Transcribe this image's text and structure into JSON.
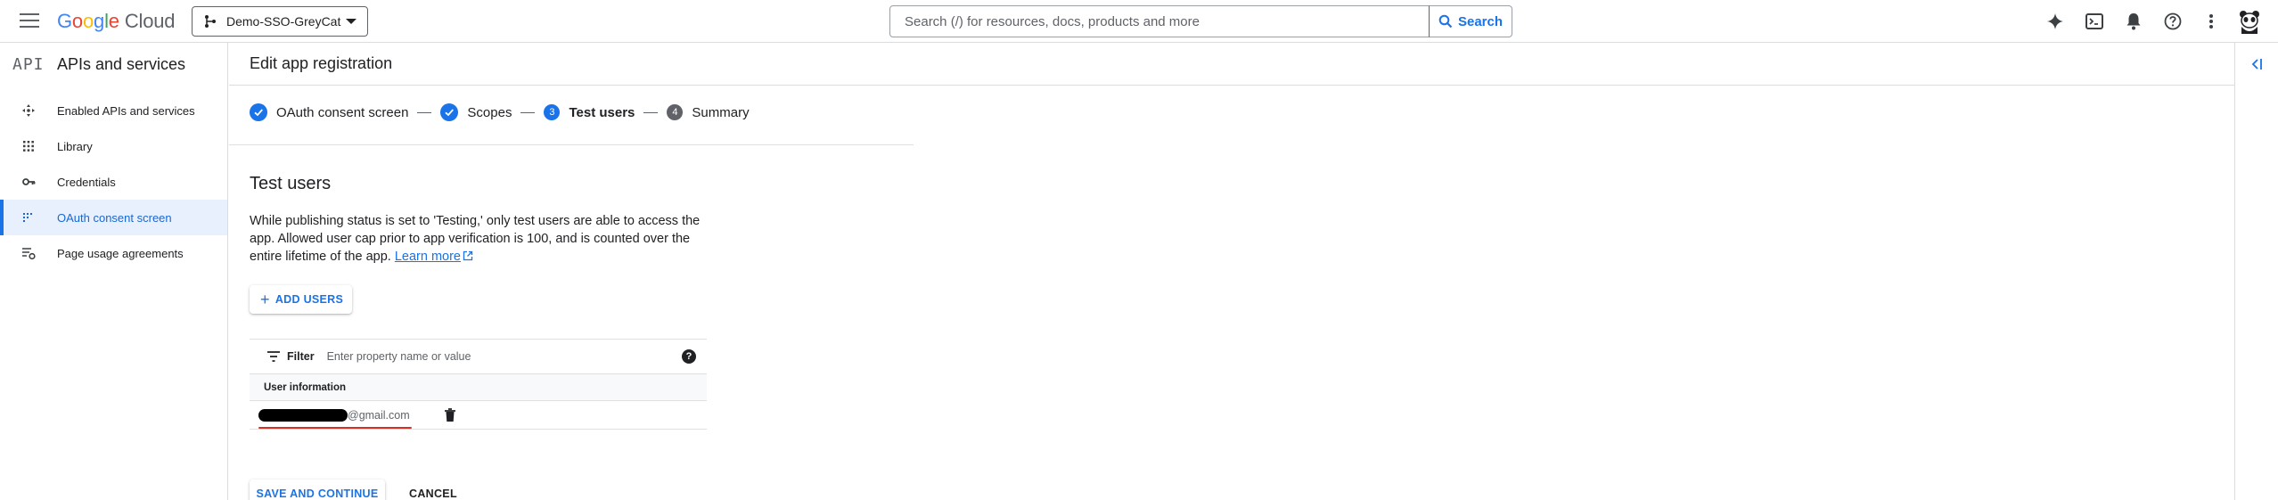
{
  "topbar": {
    "logo_google": [
      "G",
      "o",
      "o",
      "g",
      "l",
      "e"
    ],
    "logo_cloud": "Cloud",
    "project_name": "Demo-SSO-GreyCat",
    "search_placeholder": "Search (/) for resources, docs, products and more",
    "search_button": "Search",
    "icons": [
      "gemini-sparkle-icon",
      "cloud-shell-icon",
      "notifications-bell-icon",
      "help-icon",
      "more-vert-icon",
      "account-avatar-icon"
    ]
  },
  "sidebar": {
    "api_mark": "API",
    "title": "APIs and services",
    "items": [
      {
        "label": "Enabled APIs and services",
        "icon": "enabled-apis-icon"
      },
      {
        "label": "Library",
        "icon": "library-icon"
      },
      {
        "label": "Credentials",
        "icon": "key-icon"
      },
      {
        "label": "OAuth consent screen",
        "icon": "consent-screen-icon",
        "active": true
      },
      {
        "label": "Page usage agreements",
        "icon": "agreements-icon"
      }
    ]
  },
  "main": {
    "page_title": "Edit app registration",
    "steps": [
      {
        "label": "OAuth consent screen",
        "state": "done"
      },
      {
        "label": "Scopes",
        "state": "done"
      },
      {
        "number": "3",
        "label": "Test users",
        "state": "current"
      },
      {
        "number": "4",
        "label": "Summary",
        "state": "pending"
      }
    ],
    "section_title": "Test users",
    "description": "While publishing status is set to 'Testing,' only test users are able to access the app. Allowed user cap prior to app verification is 100, and is counted over the entire lifetime of the app.",
    "learn_more": "Learn more",
    "add_users_label": "ADD USERS",
    "filter_label": "Filter",
    "filter_placeholder": "Enter property name or value",
    "table_header": "User information",
    "users": [
      {
        "email_suffix": "@gmail.com"
      }
    ],
    "save_label": "SAVE AND CONTINUE",
    "cancel_label": "CANCEL"
  },
  "colors": {
    "accent": "#1a73e8",
    "active_bg": "#e8f0fe",
    "underline_red": "#d93025",
    "text": "#202124",
    "secondary": "#5f6368"
  }
}
